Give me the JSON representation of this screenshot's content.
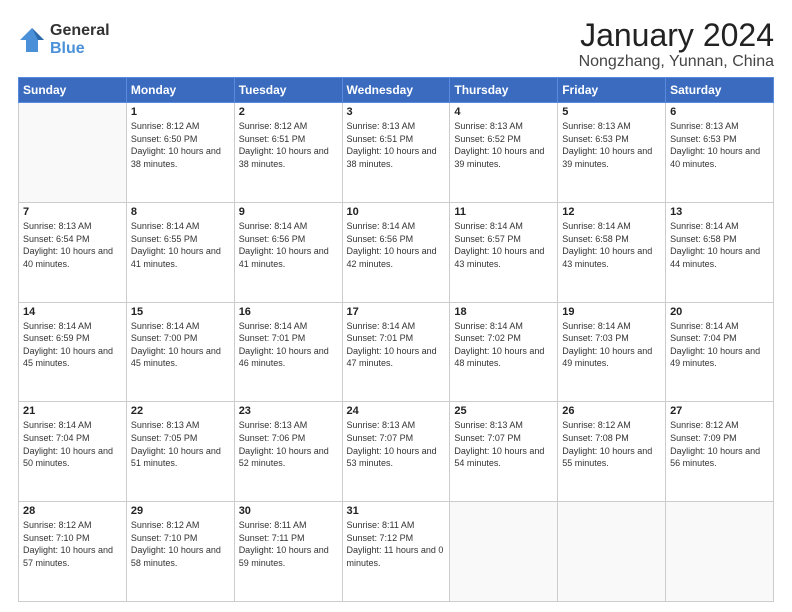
{
  "logo": {
    "general": "General",
    "blue": "Blue"
  },
  "header": {
    "month": "January 2024",
    "location": "Nongzhang, Yunnan, China"
  },
  "days_of_week": [
    "Sunday",
    "Monday",
    "Tuesday",
    "Wednesday",
    "Thursday",
    "Friday",
    "Saturday"
  ],
  "weeks": [
    [
      {
        "day": "",
        "sunrise": "",
        "sunset": "",
        "daylight": "",
        "empty": true
      },
      {
        "day": "1",
        "sunrise": "Sunrise: 8:12 AM",
        "sunset": "Sunset: 6:50 PM",
        "daylight": "Daylight: 10 hours and 38 minutes."
      },
      {
        "day": "2",
        "sunrise": "Sunrise: 8:12 AM",
        "sunset": "Sunset: 6:51 PM",
        "daylight": "Daylight: 10 hours and 38 minutes."
      },
      {
        "day": "3",
        "sunrise": "Sunrise: 8:13 AM",
        "sunset": "Sunset: 6:51 PM",
        "daylight": "Daylight: 10 hours and 38 minutes."
      },
      {
        "day": "4",
        "sunrise": "Sunrise: 8:13 AM",
        "sunset": "Sunset: 6:52 PM",
        "daylight": "Daylight: 10 hours and 39 minutes."
      },
      {
        "day": "5",
        "sunrise": "Sunrise: 8:13 AM",
        "sunset": "Sunset: 6:53 PM",
        "daylight": "Daylight: 10 hours and 39 minutes."
      },
      {
        "day": "6",
        "sunrise": "Sunrise: 8:13 AM",
        "sunset": "Sunset: 6:53 PM",
        "daylight": "Daylight: 10 hours and 40 minutes."
      }
    ],
    [
      {
        "day": "7",
        "sunrise": "Sunrise: 8:13 AM",
        "sunset": "Sunset: 6:54 PM",
        "daylight": "Daylight: 10 hours and 40 minutes."
      },
      {
        "day": "8",
        "sunrise": "Sunrise: 8:14 AM",
        "sunset": "Sunset: 6:55 PM",
        "daylight": "Daylight: 10 hours and 41 minutes."
      },
      {
        "day": "9",
        "sunrise": "Sunrise: 8:14 AM",
        "sunset": "Sunset: 6:56 PM",
        "daylight": "Daylight: 10 hours and 41 minutes."
      },
      {
        "day": "10",
        "sunrise": "Sunrise: 8:14 AM",
        "sunset": "Sunset: 6:56 PM",
        "daylight": "Daylight: 10 hours and 42 minutes."
      },
      {
        "day": "11",
        "sunrise": "Sunrise: 8:14 AM",
        "sunset": "Sunset: 6:57 PM",
        "daylight": "Daylight: 10 hours and 43 minutes."
      },
      {
        "day": "12",
        "sunrise": "Sunrise: 8:14 AM",
        "sunset": "Sunset: 6:58 PM",
        "daylight": "Daylight: 10 hours and 43 minutes."
      },
      {
        "day": "13",
        "sunrise": "Sunrise: 8:14 AM",
        "sunset": "Sunset: 6:58 PM",
        "daylight": "Daylight: 10 hours and 44 minutes."
      }
    ],
    [
      {
        "day": "14",
        "sunrise": "Sunrise: 8:14 AM",
        "sunset": "Sunset: 6:59 PM",
        "daylight": "Daylight: 10 hours and 45 minutes."
      },
      {
        "day": "15",
        "sunrise": "Sunrise: 8:14 AM",
        "sunset": "Sunset: 7:00 PM",
        "daylight": "Daylight: 10 hours and 45 minutes."
      },
      {
        "day": "16",
        "sunrise": "Sunrise: 8:14 AM",
        "sunset": "Sunset: 7:01 PM",
        "daylight": "Daylight: 10 hours and 46 minutes."
      },
      {
        "day": "17",
        "sunrise": "Sunrise: 8:14 AM",
        "sunset": "Sunset: 7:01 PM",
        "daylight": "Daylight: 10 hours and 47 minutes."
      },
      {
        "day": "18",
        "sunrise": "Sunrise: 8:14 AM",
        "sunset": "Sunset: 7:02 PM",
        "daylight": "Daylight: 10 hours and 48 minutes."
      },
      {
        "day": "19",
        "sunrise": "Sunrise: 8:14 AM",
        "sunset": "Sunset: 7:03 PM",
        "daylight": "Daylight: 10 hours and 49 minutes."
      },
      {
        "day": "20",
        "sunrise": "Sunrise: 8:14 AM",
        "sunset": "Sunset: 7:04 PM",
        "daylight": "Daylight: 10 hours and 49 minutes."
      }
    ],
    [
      {
        "day": "21",
        "sunrise": "Sunrise: 8:14 AM",
        "sunset": "Sunset: 7:04 PM",
        "daylight": "Daylight: 10 hours and 50 minutes."
      },
      {
        "day": "22",
        "sunrise": "Sunrise: 8:13 AM",
        "sunset": "Sunset: 7:05 PM",
        "daylight": "Daylight: 10 hours and 51 minutes."
      },
      {
        "day": "23",
        "sunrise": "Sunrise: 8:13 AM",
        "sunset": "Sunset: 7:06 PM",
        "daylight": "Daylight: 10 hours and 52 minutes."
      },
      {
        "day": "24",
        "sunrise": "Sunrise: 8:13 AM",
        "sunset": "Sunset: 7:07 PM",
        "daylight": "Daylight: 10 hours and 53 minutes."
      },
      {
        "day": "25",
        "sunrise": "Sunrise: 8:13 AM",
        "sunset": "Sunset: 7:07 PM",
        "daylight": "Daylight: 10 hours and 54 minutes."
      },
      {
        "day": "26",
        "sunrise": "Sunrise: 8:12 AM",
        "sunset": "Sunset: 7:08 PM",
        "daylight": "Daylight: 10 hours and 55 minutes."
      },
      {
        "day": "27",
        "sunrise": "Sunrise: 8:12 AM",
        "sunset": "Sunset: 7:09 PM",
        "daylight": "Daylight: 10 hours and 56 minutes."
      }
    ],
    [
      {
        "day": "28",
        "sunrise": "Sunrise: 8:12 AM",
        "sunset": "Sunset: 7:10 PM",
        "daylight": "Daylight: 10 hours and 57 minutes."
      },
      {
        "day": "29",
        "sunrise": "Sunrise: 8:12 AM",
        "sunset": "Sunset: 7:10 PM",
        "daylight": "Daylight: 10 hours and 58 minutes."
      },
      {
        "day": "30",
        "sunrise": "Sunrise: 8:11 AM",
        "sunset": "Sunset: 7:11 PM",
        "daylight": "Daylight: 10 hours and 59 minutes."
      },
      {
        "day": "31",
        "sunrise": "Sunrise: 8:11 AM",
        "sunset": "Sunset: 7:12 PM",
        "daylight": "Daylight: 11 hours and 0 minutes."
      },
      {
        "day": "",
        "sunrise": "",
        "sunset": "",
        "daylight": "",
        "empty": true
      },
      {
        "day": "",
        "sunrise": "",
        "sunset": "",
        "daylight": "",
        "empty": true
      },
      {
        "day": "",
        "sunrise": "",
        "sunset": "",
        "daylight": "",
        "empty": true
      }
    ]
  ]
}
